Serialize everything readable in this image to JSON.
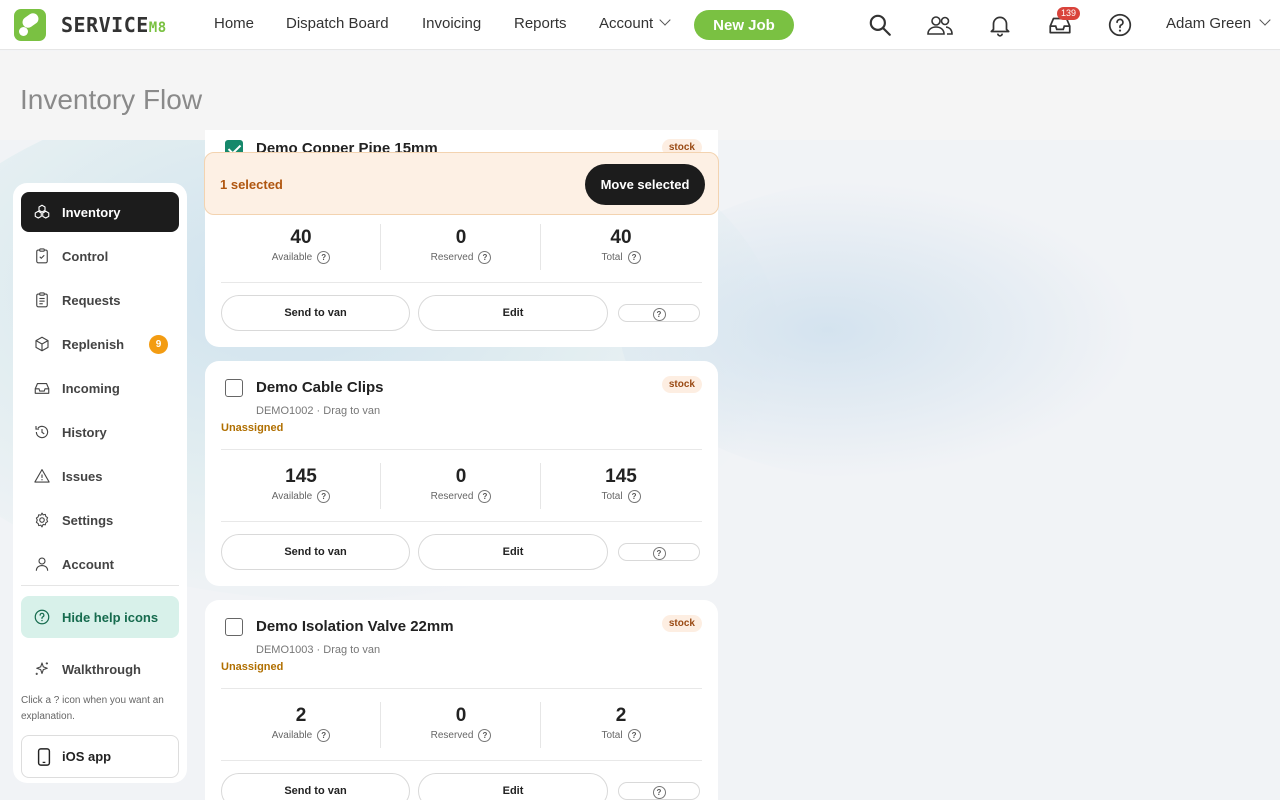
{
  "app": {
    "logo_text": "SERVICE",
    "logo_suffix": "M8"
  },
  "nav": {
    "home": "Home",
    "dispatch": "Dispatch Board",
    "invoicing": "Invoicing",
    "reports": "Reports",
    "account": "Account",
    "new_job": "New Job",
    "inbox_count": "139",
    "user": "Adam Green"
  },
  "page": {
    "title": "Inventory Flow"
  },
  "sidebar": {
    "items": [
      {
        "label": "Inventory",
        "icon": "boxes-icon",
        "active": true
      },
      {
        "label": "Control",
        "icon": "clipboard-check-icon"
      },
      {
        "label": "Requests",
        "icon": "clipboard-list-icon"
      },
      {
        "label": "Replenish",
        "icon": "package-icon",
        "badge": "9"
      },
      {
        "label": "Incoming",
        "icon": "inbox-icon"
      },
      {
        "label": "History",
        "icon": "history-icon"
      },
      {
        "label": "Issues",
        "icon": "warning-icon"
      },
      {
        "label": "Settings",
        "icon": "gear-icon"
      },
      {
        "label": "Account",
        "icon": "user-icon"
      }
    ],
    "help_toggle": "Hide help icons",
    "walkthrough": "Walkthrough",
    "note": "Click a ? icon when you want an explanation.",
    "ios_app": "iOS app"
  },
  "selection": {
    "count_label": "1 selected",
    "move_button": "Move selected"
  },
  "cards": [
    {
      "name": "Demo Copper Pipe 15mm",
      "tag": "stock",
      "checked": true,
      "available": "40",
      "reserved": "0",
      "total": "40",
      "labels": {
        "available": "Available",
        "reserved": "Reserved",
        "total": "Total"
      },
      "send": "Send to van",
      "edit": "Edit"
    },
    {
      "name": "Demo Cable Clips",
      "tag": "stock",
      "checked": false,
      "meta": "DEMO1002 · Drag to van",
      "assignment": "Unassigned",
      "available": "145",
      "reserved": "0",
      "total": "145",
      "labels": {
        "available": "Available",
        "reserved": "Reserved",
        "total": "Total"
      },
      "send": "Send to van",
      "edit": "Edit"
    },
    {
      "name": "Demo Isolation Valve 22mm",
      "tag": "stock",
      "checked": false,
      "meta": "DEMO1003 · Drag to van",
      "assignment": "Unassigned",
      "available": "2",
      "reserved": "0",
      "total": "2",
      "labels": {
        "available": "Available",
        "reserved": "Reserved",
        "total": "Total"
      },
      "send": "Send to van",
      "edit": "Edit"
    }
  ],
  "colors": {
    "brand_green": "#7ac142",
    "active_dark": "#1c1c1c",
    "help_green": "#166b4e",
    "badge_orange": "#f39c12",
    "unassigned": "#b06f00"
  }
}
